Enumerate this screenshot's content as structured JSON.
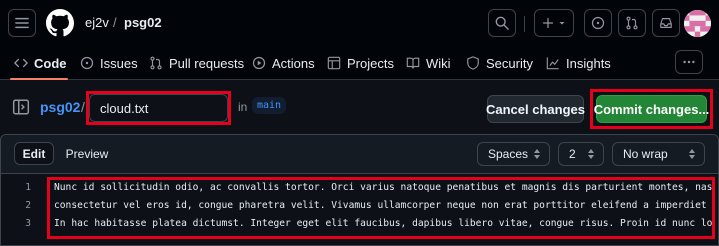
{
  "header": {
    "owner": "ej2v",
    "separator": "/",
    "repo": "psg02"
  },
  "tabs": [
    {
      "label": "Code",
      "icon": "code-icon"
    },
    {
      "label": "Issues",
      "icon": "issue-icon"
    },
    {
      "label": "Pull requests",
      "icon": "pull-request-icon"
    },
    {
      "label": "Actions",
      "icon": "play-icon"
    },
    {
      "label": "Projects",
      "icon": "table-icon"
    },
    {
      "label": "Wiki",
      "icon": "book-icon"
    },
    {
      "label": "Security",
      "icon": "shield-icon"
    },
    {
      "label": "Insights",
      "icon": "graph-icon"
    }
  ],
  "editor_bar": {
    "repo_link": "psg02",
    "separator": "/",
    "filename": "cloud.txt",
    "in_label": "in",
    "branch": "main",
    "cancel_label": "Cancel changes",
    "commit_label": "Commit changes..."
  },
  "toolbar": {
    "edit_tab": "Edit",
    "preview_tab": "Preview",
    "indent_mode": "Spaces",
    "indent_size": "2",
    "wrap_mode": "No wrap"
  },
  "code": {
    "lines": [
      {
        "number": "1",
        "text": "Nunc id sollicitudin odio, ac convallis tortor. Orci varius natoque penatibus et magnis dis parturient montes, nascetur ridiculus mus."
      },
      {
        "number": "2",
        "text": "consectetur vel eros id, congue pharetra velit. Vivamus ullamcorper neque non erat porttitor eleifend a imperdiet ante."
      },
      {
        "number": "3",
        "text": "In hac habitasse platea dictumst. Integer eget elit faucibus, dapibus libero vitae, congue risus. Proin id nunc lorem."
      }
    ]
  },
  "colors": {
    "background": "#0d1117",
    "commit_button": "#238636",
    "link": "#4493f8",
    "highlight_box": "#e5001b"
  }
}
